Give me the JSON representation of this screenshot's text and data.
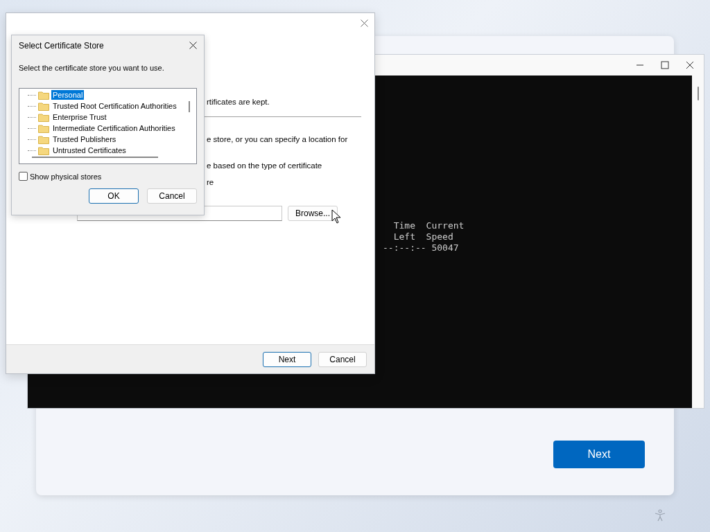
{
  "setup_card": {
    "next_button": "Next"
  },
  "console_window": {
    "lines": [
      "  Time  Current",
      "  Left  Speed",
      "--:--:-- 50047"
    ]
  },
  "wizard": {
    "fragments": [
      "rtificates are kept.",
      "e store, or you can specify a location for",
      "e based on the type of certificate",
      "re"
    ],
    "browse_button": {
      "label": "Browse..."
    },
    "buttons": [
      {
        "label": "Next",
        "default": true
      },
      {
        "label": "Cancel",
        "default": false
      }
    ]
  },
  "dialog": {
    "title": "Select Certificate Store",
    "instruction": "Select the certificate store you want to use.",
    "stores": [
      {
        "label": "Personal",
        "selected": true
      },
      {
        "label": "Trusted Root Certification Authorities",
        "selected": false
      },
      {
        "label": "Enterprise Trust",
        "selected": false
      },
      {
        "label": "Intermediate Certification Authorities",
        "selected": false
      },
      {
        "label": "Trusted Publishers",
        "selected": false
      },
      {
        "label": "Untrusted Certificates",
        "selected": false
      }
    ],
    "show_physical": {
      "label": "Show physical stores",
      "checked": false
    },
    "buttons": [
      {
        "label": "OK",
        "default": true
      },
      {
        "label": "Cancel",
        "default": false
      }
    ]
  }
}
